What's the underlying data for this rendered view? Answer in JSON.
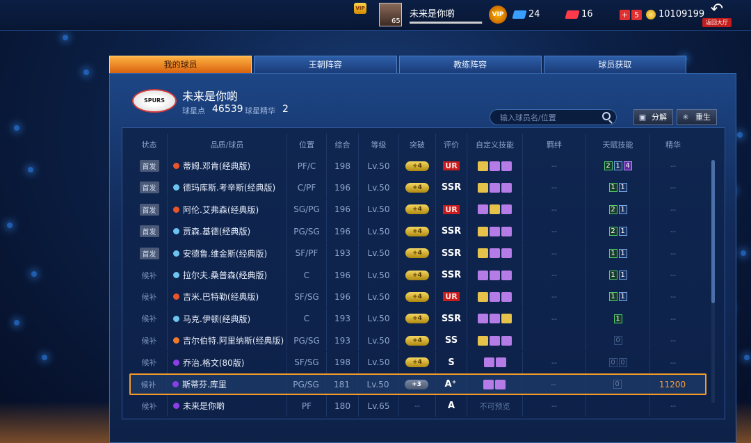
{
  "topbar": {
    "vip_small_label": "VIP",
    "avatar_level": "65",
    "player_name": "未来是你啲",
    "exp_fraction": 0.98,
    "vip_label": "VIP",
    "tickets_blue": "24",
    "tickets_red": "16",
    "plus_label": "+",
    "minus_label": "5",
    "coins": "10109199",
    "back_label": "返回大厅"
  },
  "tabs": [
    "我的球员",
    "王朝阵容",
    "教练阵容",
    "球员获取"
  ],
  "team": {
    "logo_text": "SPURS",
    "name": "未来是你啲",
    "points_label": "球星点",
    "points_value": "46539",
    "essence_label": "球星精华",
    "essence_value": "2"
  },
  "search": {
    "placeholder": "输入球员名/位置"
  },
  "buttons": {
    "decompose": "分解",
    "rebirth": "重生"
  },
  "table": {
    "headers": [
      "状态",
      "品质/球员",
      "位置",
      "综合",
      "等级",
      "突破",
      "评价",
      "自定义技能",
      "羁绊",
      "天赋技能",
      "精华"
    ],
    "rows": [
      {
        "status": "首发",
        "starter": true,
        "dot": "#e8552a",
        "name": "蒂姆.邓肯(经典版)",
        "pos": "PF/C",
        "ovr": "198",
        "lvl": "Lv.50",
        "brk": "+4",
        "rate": "UR",
        "skills": [
          "#e6c24a",
          "#b57be6",
          "#b57be6"
        ],
        "bond": "--",
        "talents": [
          [
            "2",
            "green"
          ],
          [
            "1",
            "blue"
          ],
          [
            "4",
            "pur"
          ]
        ],
        "ess": "--"
      },
      {
        "status": "首发",
        "starter": true,
        "dot": "#6cc3f0",
        "name": "德玛库斯.考辛斯(经典版)",
        "pos": "C/PF",
        "ovr": "196",
        "lvl": "Lv.50",
        "brk": "+4",
        "rate": "SSR",
        "skills": [
          "#e6c24a",
          "#b57be6",
          "#b57be6"
        ],
        "bond": "--",
        "talents": [
          [
            "1",
            "green"
          ],
          [
            "1",
            "blue"
          ]
        ],
        "ess": "--"
      },
      {
        "status": "首发",
        "starter": true,
        "dot": "#e8552a",
        "name": "阿伦.艾弗森(经典版)",
        "pos": "SG/PG",
        "ovr": "196",
        "lvl": "Lv.50",
        "brk": "+4",
        "rate": "UR",
        "skills": [
          "#b57be6",
          "#e6c24a",
          "#b57be6"
        ],
        "bond": "--",
        "talents": [
          [
            "2",
            "green"
          ],
          [
            "1",
            "blue"
          ]
        ],
        "ess": "--"
      },
      {
        "status": "首发",
        "starter": true,
        "dot": "#6cc3f0",
        "name": "贾森.基德(经典版)",
        "pos": "PG/SG",
        "ovr": "196",
        "lvl": "Lv.50",
        "brk": "+4",
        "rate": "SSR",
        "skills": [
          "#e6c24a",
          "#b57be6",
          "#b57be6"
        ],
        "bond": "--",
        "talents": [
          [
            "2",
            "green"
          ],
          [
            "1",
            "blue"
          ]
        ],
        "ess": "--"
      },
      {
        "status": "首发",
        "starter": true,
        "dot": "#6cc3f0",
        "name": "安德鲁.维金斯(经典版)",
        "pos": "SF/PF",
        "ovr": "193",
        "lvl": "Lv.50",
        "brk": "+4",
        "rate": "SSR",
        "skills": [
          "#e6c24a",
          "#b57be6",
          "#b57be6"
        ],
        "bond": "--",
        "talents": [
          [
            "1",
            "green"
          ],
          [
            "1",
            "blue"
          ]
        ],
        "ess": "--"
      },
      {
        "status": "候补",
        "starter": false,
        "dot": "#6cc3f0",
        "name": "拉尔夫.桑普森(经典版)",
        "pos": "C",
        "ovr": "196",
        "lvl": "Lv.50",
        "brk": "+4",
        "rate": "SSR",
        "skills": [
          "#b57be6",
          "#b57be6",
          "#b57be6"
        ],
        "bond": "--",
        "talents": [
          [
            "1",
            "green"
          ],
          [
            "1",
            "blue"
          ]
        ],
        "ess": "--"
      },
      {
        "status": "候补",
        "starter": false,
        "dot": "#e8552a",
        "name": "吉米.巴特勒(经典版)",
        "pos": "SF/SG",
        "ovr": "196",
        "lvl": "Lv.50",
        "brk": "+4",
        "rate": "UR",
        "skills": [
          "#e6c24a",
          "#b57be6",
          "#b57be6"
        ],
        "bond": "--",
        "talents": [
          [
            "1",
            "green"
          ],
          [
            "1",
            "blue"
          ]
        ],
        "ess": "--"
      },
      {
        "status": "候补",
        "starter": false,
        "dot": "#6cc3f0",
        "name": "马克.伊顿(经典版)",
        "pos": "C",
        "ovr": "193",
        "lvl": "Lv.50",
        "brk": "+4",
        "rate": "SSR",
        "skills": [
          "#b57be6",
          "#b57be6",
          "#e6c24a"
        ],
        "bond": "--",
        "talents": [
          [
            "1",
            "green"
          ]
        ],
        "ess": "--"
      },
      {
        "status": "候补",
        "starter": false,
        "dot": "#f07a2a",
        "name": "吉尔伯特.阿里纳斯(经典版)",
        "pos": "PG/SG",
        "ovr": "193",
        "lvl": "Lv.50",
        "brk": "+4",
        "rate": "SS",
        "skills": [
          "#e6c24a",
          "#b57be6",
          "#b57be6"
        ],
        "bond": "",
        "talents": [
          [
            "0",
            "dim"
          ]
        ],
        "ess": "--"
      },
      {
        "status": "候补",
        "starter": false,
        "dot": "#8a3fe6",
        "name": "乔治.格文(80版)",
        "pos": "SF/SG",
        "ovr": "198",
        "lvl": "Lv.50",
        "brk": "+4",
        "rate": "S",
        "skills": [
          "#b57be6",
          "#b57be6"
        ],
        "bond": "--",
        "talents": [
          [
            "0",
            "dim"
          ],
          [
            "0",
            "dim"
          ]
        ],
        "ess": "--"
      },
      {
        "status": "候补",
        "starter": false,
        "dot": "#8a3fe6",
        "name": "斯蒂芬.库里",
        "pos": "PG/SG",
        "ovr": "181",
        "lvl": "Lv.50",
        "brk": "+3",
        "rate": "A⁺",
        "skills": [
          "#b57be6",
          "#b57be6"
        ],
        "bond": "--",
        "talents": [
          [
            "0",
            "dim"
          ]
        ],
        "ess": "11200",
        "highlight": true
      },
      {
        "status": "候补",
        "starter": false,
        "dot": "#8a3fe6",
        "name": "未来是你啲",
        "pos": "PF",
        "ovr": "180",
        "lvl": "Lv.65",
        "brk": "--",
        "rate": "A",
        "skills_text": "不可预览",
        "skills": [],
        "bond": "--",
        "talents": [],
        "ess": "--"
      }
    ]
  },
  "colors": {
    "accent_orange": "#f29b2b",
    "tab_active": "#d9620e"
  }
}
